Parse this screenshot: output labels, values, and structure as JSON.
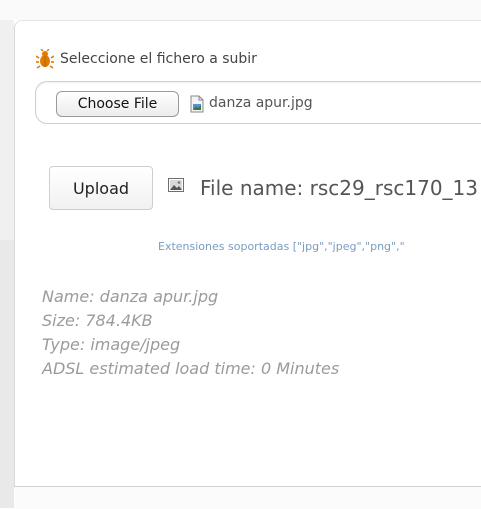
{
  "upload_section": {
    "label": "Seleccione el fichero a subir",
    "choose_file_label": "Choose File",
    "chosen_file": "danza apur.jpg",
    "upload_button": "Upload",
    "file_name_text": "File name: rsc29_rsc170_13",
    "supported_extensions": "Extensiones soportadas [\"jpg\",\"jpeg\",\"png\",\""
  },
  "file_info": {
    "name": "Name: danza apur.jpg",
    "size": "Size: 784.4KB",
    "type": "Type: image/jpeg",
    "load_time": "ADSL estimated load time: 0 Minutes"
  },
  "icons": {
    "label_icon": "bug-icon",
    "file_icon": "document-icon",
    "preview_icon": "image-icon"
  },
  "colors": {
    "accent": "#e07b00",
    "extensions_text": "#7a9cc0",
    "info_text": "#9b9b9b"
  }
}
